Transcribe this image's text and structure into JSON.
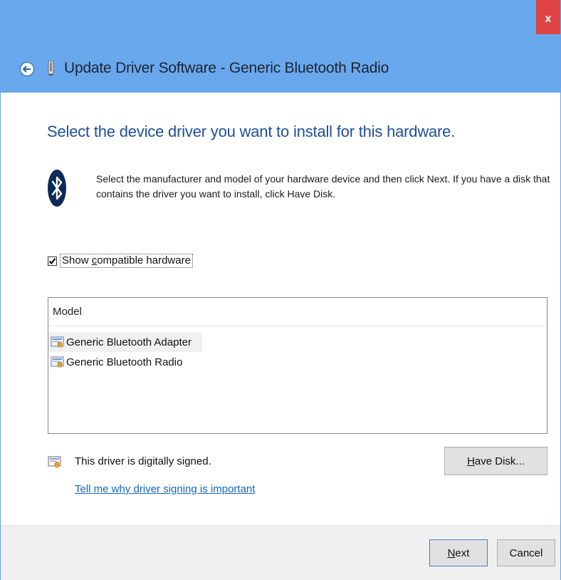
{
  "window": {
    "title": "Update Driver Software - Generic Bluetooth Radio",
    "close_label": "x",
    "accent_color": "#6aa8ee",
    "close_color": "#e04343"
  },
  "main": {
    "heading": "Select the device driver you want to install for this hardware.",
    "instruction": "Select the manufacturer and model of your hardware device and then click Next. If you have a disk that contains the driver you want to install, click Have Disk.",
    "icon": "bluetooth-icon"
  },
  "compatible": {
    "checked": true,
    "label_pre": "Show ",
    "label_accel": "c",
    "label_post": "ompatible hardware"
  },
  "model_list": {
    "header": "Model",
    "items": [
      {
        "label": "Generic Bluetooth Adapter",
        "selected": true
      },
      {
        "label": "Generic Bluetooth Radio",
        "selected": false
      }
    ]
  },
  "signing": {
    "text": "This driver is digitally signed.",
    "link": "Tell me why driver signing is important",
    "have_disk_accel": "H",
    "have_disk_rest": "ave Disk..."
  },
  "footer": {
    "next_accel": "N",
    "next_rest": "ext",
    "cancel": "Cancel"
  }
}
